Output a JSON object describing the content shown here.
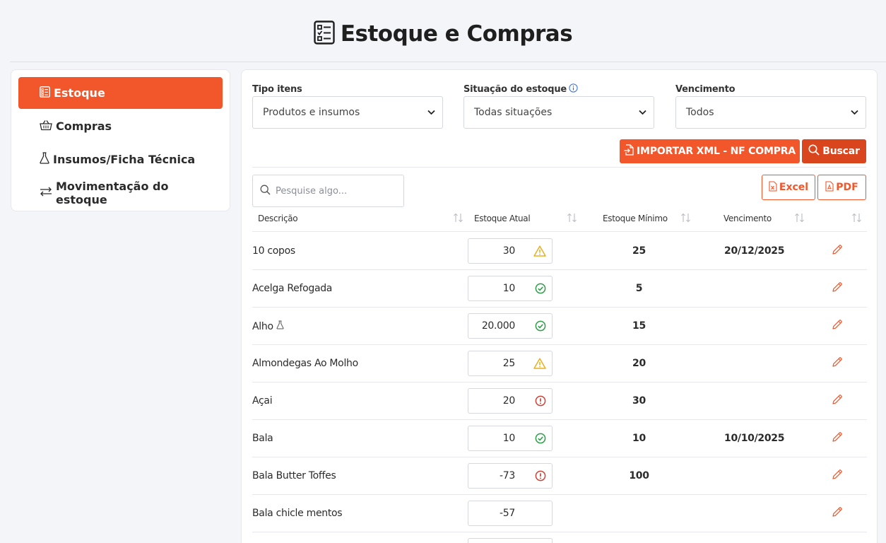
{
  "header": {
    "title": "Estoque e Compras"
  },
  "sidebar": {
    "items": [
      {
        "label": "Estoque",
        "icon": "list-icon",
        "active": true
      },
      {
        "label": "Compras",
        "icon": "basket-icon",
        "active": false
      },
      {
        "label": "Insumos/Ficha Técnica",
        "icon": "flask-icon",
        "active": false
      },
      {
        "label": "Movimentação do estoque",
        "icon": "arrows-icon",
        "active": false
      }
    ]
  },
  "filters": {
    "tipo": {
      "label": "Tipo itens",
      "value": "Produtos e insumos"
    },
    "situacao": {
      "label": "Situação do estoque",
      "value": "Todas situações"
    },
    "vencimento": {
      "label": "Vencimento",
      "value": "Todos"
    }
  },
  "actions": {
    "import_label": "IMPORTAR XML - NF COMPRA",
    "search_label": "Buscar",
    "excel_label": "Excel",
    "pdf_label": "PDF"
  },
  "search": {
    "placeholder": "Pesquise algo..."
  },
  "table": {
    "columns": [
      "Descrição",
      "Estoque Atual",
      "Estoque Mínimo",
      "Vencimento"
    ],
    "rows": [
      {
        "desc": "10 copos",
        "estoque": "30",
        "status": "warning",
        "minimo": "25",
        "vencimento": "20/12/2025",
        "insumo": false
      },
      {
        "desc": "Acelga Refogada",
        "estoque": "10",
        "status": "ok",
        "minimo": "5",
        "vencimento": "",
        "insumo": false
      },
      {
        "desc": "Alho",
        "estoque": "20.000",
        "status": "ok",
        "minimo": "15",
        "vencimento": "",
        "insumo": true
      },
      {
        "desc": "Almondegas Ao Molho",
        "estoque": "25",
        "status": "warning",
        "minimo": "20",
        "vencimento": "",
        "insumo": false
      },
      {
        "desc": "Açai",
        "estoque": "20",
        "status": "danger",
        "minimo": "30",
        "vencimento": "",
        "insumo": false
      },
      {
        "desc": "Bala",
        "estoque": "10",
        "status": "ok",
        "minimo": "10",
        "vencimento": "10/10/2025",
        "insumo": false
      },
      {
        "desc": "Bala Butter Toffes",
        "estoque": "-73",
        "status": "danger",
        "minimo": "100",
        "vencimento": "",
        "insumo": false
      },
      {
        "desc": "Bala chicle mentos",
        "estoque": "-57",
        "status": "none",
        "minimo": "",
        "vencimento": "",
        "insumo": false
      }
    ]
  },
  "colors": {
    "accent": "#f2562b",
    "accent_dark": "#d9461e",
    "ok": "#2e9e47",
    "warning": "#e8b020",
    "danger": "#c9453a"
  }
}
